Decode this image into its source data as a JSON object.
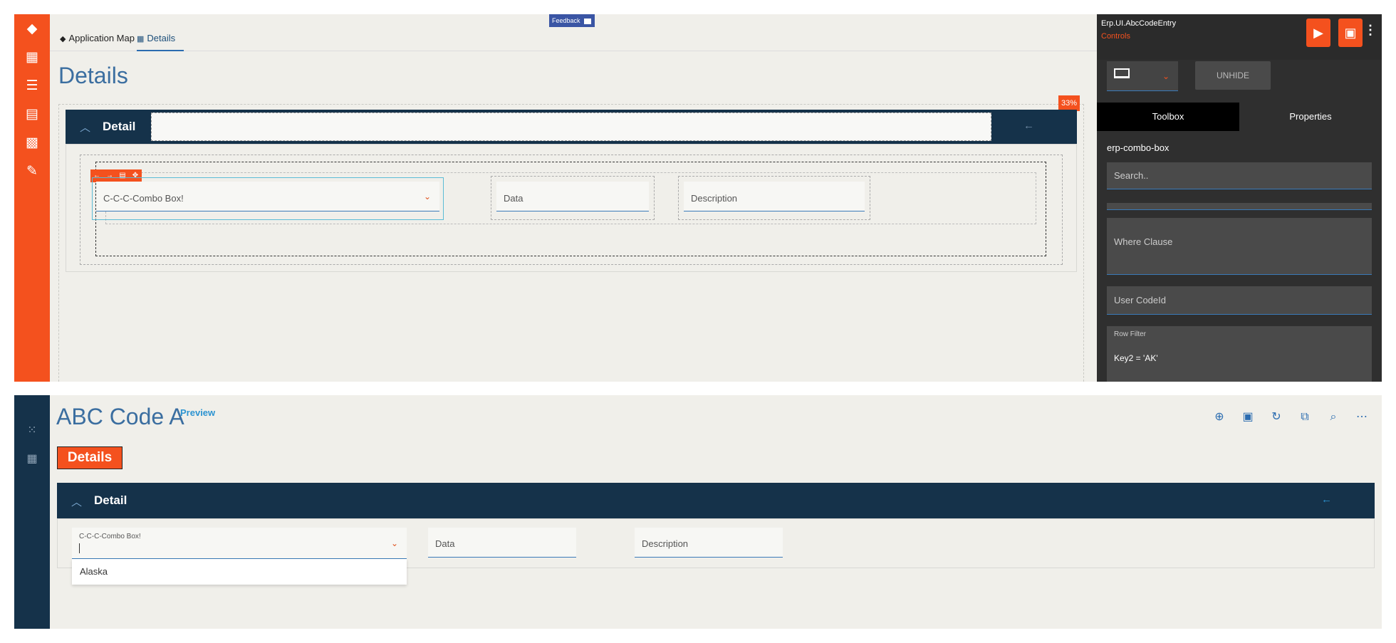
{
  "designer": {
    "tabs": {
      "app_map": "Application Map",
      "details": "Details"
    },
    "feedback": "Feedback",
    "page_title": "Details",
    "zoom_badge": "33%",
    "section": {
      "title": "Detail",
      "collapse_icon": "chevron-up-icon",
      "nav_icon": "arrow-left-icon"
    },
    "fields": {
      "combo": "C-C-C-Combo Box!",
      "data": "Data",
      "description": "Description"
    },
    "mini_toolbar": [
      "←",
      "→",
      "▤",
      "✥"
    ]
  },
  "panel": {
    "app_name": "Erp.UI.AbcCodeEntry",
    "section": "Controls",
    "unhide_label": "UNHIDE",
    "tabs": {
      "toolbox": "Toolbox",
      "properties": "Properties"
    },
    "active_tab": "Toolbox",
    "control_name": "erp-combo-box",
    "search_placeholder": "Search..",
    "where_clause": "Where Clause",
    "user_code_id": "User CodeId",
    "row_filter_label": "Row Filter",
    "row_filter_value": "Key2 = 'AK'"
  },
  "preview": {
    "title": "ABC Code A",
    "badge": "Preview",
    "details_button": "Details",
    "section_title": "Detail",
    "combo_label": "C-C-C-Combo Box!",
    "data_label": "Data",
    "description_label": "Description",
    "dropdown_options": [
      "Alaska"
    ],
    "toolbar_icons": [
      "add-icon",
      "save-icon",
      "refresh-icon",
      "copy-icon",
      "search-icon",
      "more-icon"
    ]
  },
  "colors": {
    "accent": "#f4511e",
    "navy": "#15324a",
    "link": "#2b6cb0"
  }
}
